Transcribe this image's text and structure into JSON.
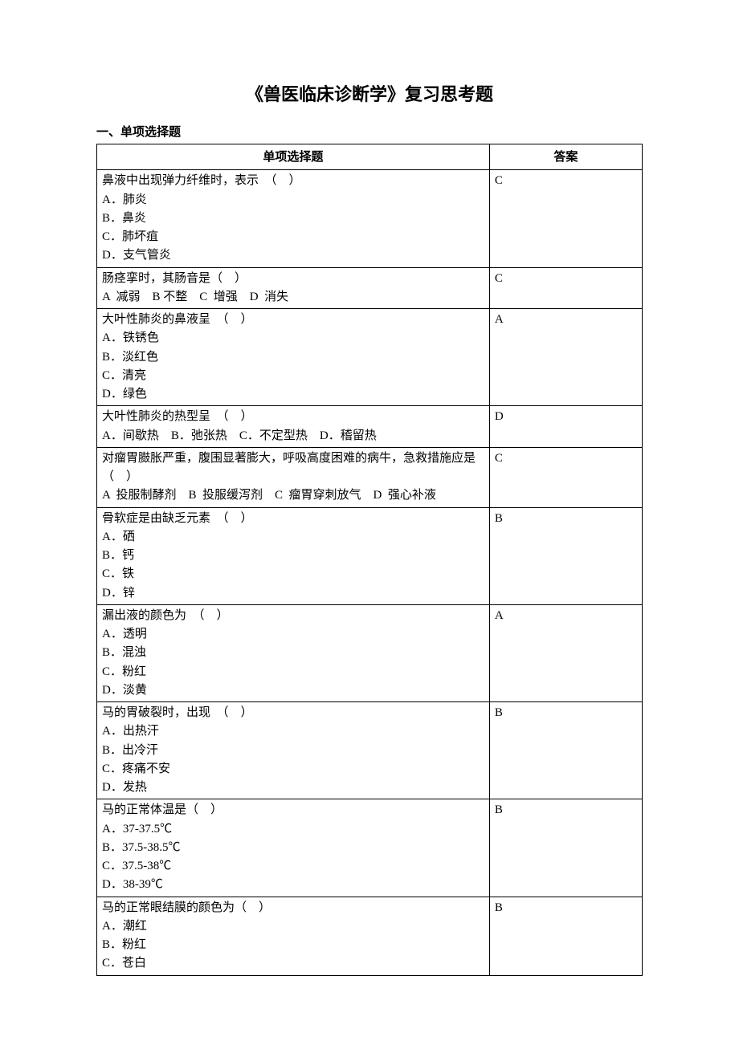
{
  "title": "《兽医临床诊断学》复习思考题",
  "section_header": "一、单项选择题",
  "table_headers": {
    "question": "单项选择题",
    "answer": "答案"
  },
  "questions": [
    {
      "stem": "鼻液中出现弹力纤维时，表示　（　）",
      "options": [
        "A．肺炎",
        "B．鼻炎",
        "C．肺坏疽",
        "D．支气管炎"
      ],
      "layout": "vertical",
      "answer": "C"
    },
    {
      "stem": "肠痉挛时，其肠音是（　）",
      "options": [
        "A  减弱",
        "B 不整",
        "C  增强",
        "D  消失"
      ],
      "layout": "horizontal",
      "answer": "C"
    },
    {
      "stem": "大叶性肺炎的鼻液呈　（　）",
      "options": [
        "A．铁锈色",
        "B．淡红色",
        "C．清亮",
        "D．绿色"
      ],
      "layout": "vertical",
      "answer": "A"
    },
    {
      "stem": "大叶性肺炎的热型呈　（　）",
      "options": [
        "A．间歇热",
        "B．弛张热",
        "C．不定型热",
        "D．稽留热"
      ],
      "layout": "horizontal",
      "answer": "D"
    },
    {
      "stem": "对瘤胃臌胀严重，腹围显著膨大，呼吸高度困难的病牛，急救措施应是（　）",
      "options": [
        "A  投服制酵剂",
        "B  投服缓泻剂",
        "C  瘤胃穿刺放气",
        "D  强心补液"
      ],
      "layout": "horizontal",
      "answer": "C"
    },
    {
      "stem": "骨软症是由缺乏元素　（　）",
      "options": [
        "A．硒",
        "B．钙",
        "C．铁",
        "D．锌"
      ],
      "layout": "vertical",
      "answer": "B"
    },
    {
      "stem": "漏出液的颜色为　（　）",
      "options": [
        "A．透明",
        "B．混浊",
        "C．粉红",
        "D．淡黄"
      ],
      "layout": "vertical",
      "answer": "A"
    },
    {
      "stem": "马的胃破裂时，出现　（　）",
      "options": [
        "A．出热汗",
        "B．出冷汗",
        "C．疼痛不安",
        "D．发热"
      ],
      "layout": "vertical",
      "answer": "B"
    },
    {
      "stem": "马的正常体温是（　）",
      "options": [
        "A．37-37.5℃",
        "B．37.5-38.5℃",
        "C．37.5-38℃",
        "D．38-39℃"
      ],
      "layout": "vertical",
      "answer": "B"
    },
    {
      "stem": "马的正常眼结膜的颜色为（　）",
      "options": [
        "A．潮红",
        "B．粉红",
        "C．苍白"
      ],
      "layout": "vertical",
      "answer": "B"
    }
  ]
}
